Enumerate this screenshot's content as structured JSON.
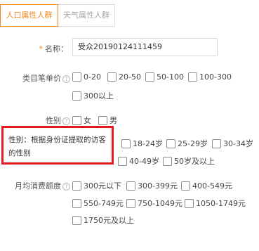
{
  "tabs": [
    {
      "label": "人口属性人群",
      "active": true
    },
    {
      "label": "天气属性人群",
      "active": false
    }
  ],
  "name_field": {
    "label": "名称：",
    "required_mark": "*",
    "value": "受众20190124111459"
  },
  "category_price": {
    "label": "类目笔单价",
    "help_icon": "question-circle-icon",
    "options": [
      "0-20",
      "20-50",
      "50-100",
      "100-300",
      "300以上"
    ]
  },
  "gender": {
    "label": "性别",
    "help_icon": "question-circle-icon",
    "options": [
      "女",
      "男"
    ]
  },
  "age": {
    "options": [
      "18-24岁",
      "25-29岁",
      "30-34岁",
      "40-49岁",
      "50岁及以上"
    ]
  },
  "monthly_spend": {
    "label": "月均消费额度",
    "help_icon": "question-circle-icon",
    "options": [
      "300元以下",
      "300-399元",
      "400-549元",
      "550-749元",
      "750-1049元",
      "1050-1749元",
      "1750元及以上"
    ]
  },
  "tooltip": {
    "text": "性别：根据身份证提取的访客的性别",
    "highlight_color": "#e2191f"
  },
  "colors": {
    "accent": "#f08a1c",
    "border": "#d9d9d9",
    "highlight": "#e2191f"
  }
}
